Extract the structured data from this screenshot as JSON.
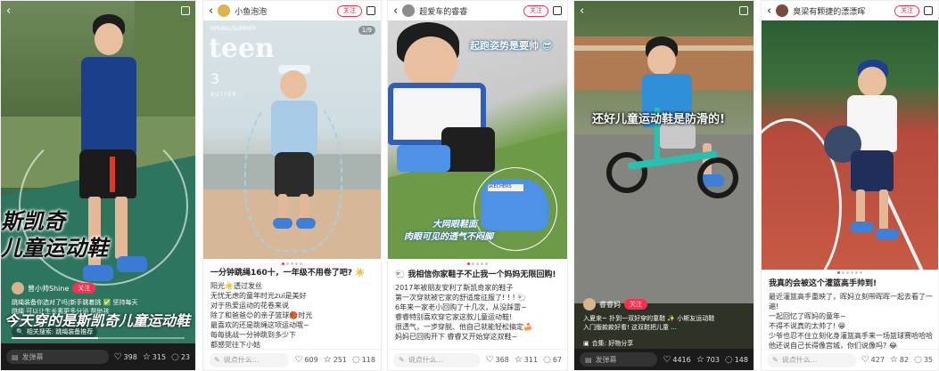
{
  "cards": [
    {
      "overlay_big": "斯凯奇",
      "overlay_big2": "儿童运动鞋",
      "overlay_bottom": "今天穿的是斯凯奇儿童运动鞋",
      "author": "曾小帅Shine",
      "follow": "关注",
      "desc1": "跳绳装备你选对了吗|新手跳着挑 ✅ 坚持每天",
      "desc2": "跳绳 可以让生长素更多分泌 帮助孩",
      "related": "相关搜索: 跳绳装备推荐",
      "say": "发弹幕",
      "likes": "398",
      "stars": "315",
      "comments": "23",
      "progress": 0.5
    },
    {
      "author": "小鱼泡泡",
      "follow": "关注",
      "page": "1/9",
      "mag_small": "SPRING/SUMMER",
      "mag_title": "teen",
      "mag_num": "3",
      "mag_word": "BUTTER",
      "title": "一分钟跳绳160十，一年级不用卷了吧? ☀️",
      "lines": [
        "阳光☀️透过发丝",
        "无忧无虑的童年时光zui是美好",
        "对于热爱运动的花卷来说",
        "除了和爸爸😊的亲子篮球🏀时光",
        "最喜欢的还是跳绳这项运动哦~",
        "每每挑战一分钟跳到多少下",
        "都感觉往下小姑"
      ],
      "say": "说点什么...",
      "likes": "609",
      "stars": "251",
      "comments": "118"
    },
    {
      "author": "超爱车的睿睿",
      "follow": "关注",
      "overlay_top": "起跑姿势是要帅 😎",
      "overlay_mid1": "大网眼鞋面",
      "overlay_mid2": "肉眼可见的透气不闷脚",
      "title": "🐑 我相信你家鞋子不止我一个妈妈无限回购!",
      "lines": [
        "2017年被朋友安利了斯凯奇家的鞋子",
        "第一次穿就被它家的舒适度征服了! ! ! 🐑",
        "6年来一家老小回购了十几次，从没踩雷~",
        "睿睿特别喜欢穿它家这款儿童运动鞋!",
        "很透气，一步穿脱、他自己就能轻松搞定🍰",
        "妈妈已回购开下   睿睿又开始穿这双鞋~"
      ],
      "say": "说点什么...",
      "likes": "368",
      "stars": "311",
      "comments": "67"
    },
    {
      "overlay_big": "还好儿童运动鞋是防滑的!",
      "author": "睿睿妈",
      "follow": "关注",
      "desc1": "入夏来~ 扑到一双好穿的童鞋 ✨ 小斯友运动鞋",
      "desc2": "入门版款款好看! 这双鞋把儿童 ...",
      "topic": "合集: 好物分享",
      "say": "发弹幕",
      "likes": "4416",
      "stars": "703",
      "comments": "148"
    },
    {
      "author": "臭梁有颗捷的漂漂晖",
      "follow": "关注",
      "title": "我真的会被这个灌篮高手帅到!",
      "lines": [
        "最近灌篮高手重映了，晖妈立刻带晖晖一起去看了一遍!",
        "一起回忆了晖妈的童年~",
        "不得不说真的太帅了! 😁",
        "少爷也忍不住立刻化身灌篮高手来一场篮球赛哈哈哈😂",
        "他还说自己长得像宫城，你们说像吗? 😂"
      ],
      "say": "说点什么...",
      "likes": "427",
      "stars": "82",
      "comments": "35"
    }
  ]
}
